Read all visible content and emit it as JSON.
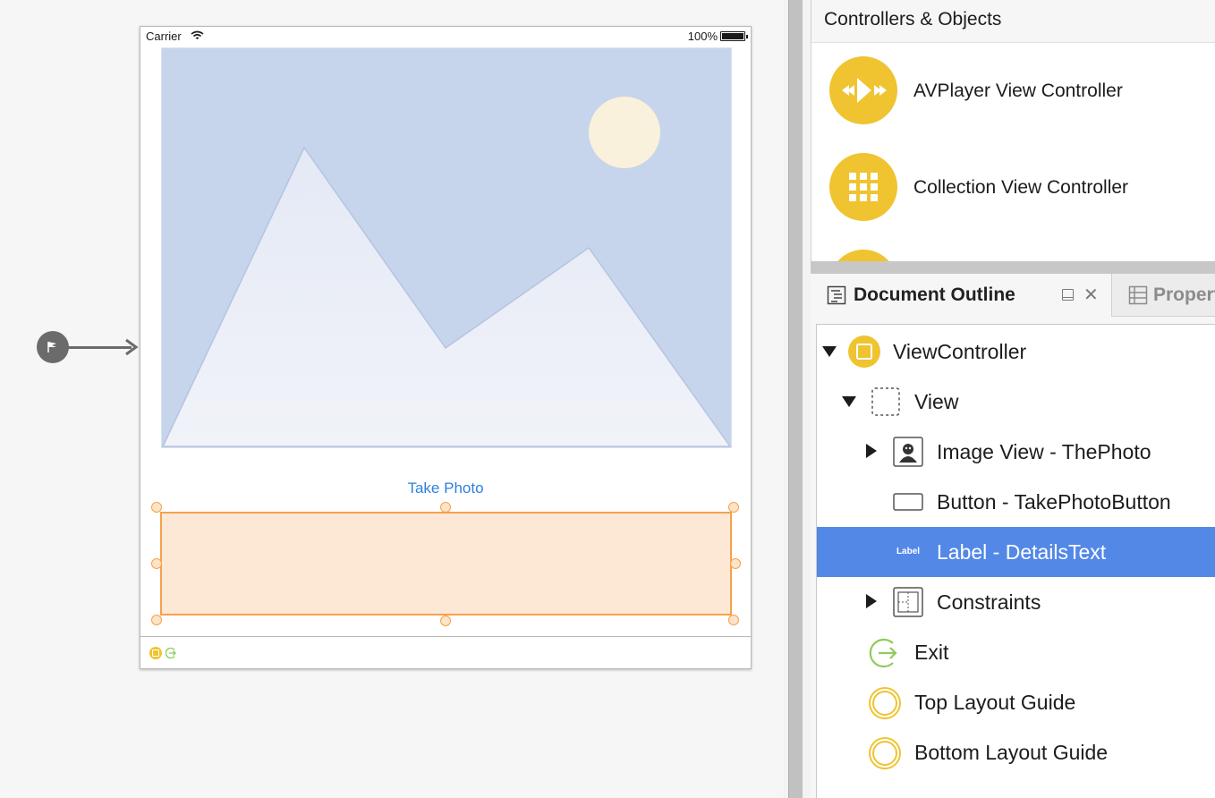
{
  "status_bar": {
    "carrier": "Carrier",
    "battery": "100%"
  },
  "scene": {
    "button_title": "Take Photo"
  },
  "library": {
    "header": "Controllers & Objects",
    "items": [
      {
        "label": "AVPlayer View Controller",
        "icon": "avplayer-icon"
      },
      {
        "label": "Collection View Controller",
        "icon": "collection-grid-icon"
      }
    ]
  },
  "tabs": {
    "document_outline": "Document Outline",
    "properties": "Properties"
  },
  "outline": {
    "selected_index": 3,
    "rows": [
      {
        "label": "ViewController",
        "icon": "view-controller-icon",
        "disclosure": "open"
      },
      {
        "label": "View",
        "icon": "view-icon",
        "disclosure": "open"
      },
      {
        "label": "Image View - ThePhoto",
        "icon": "image-view-icon",
        "disclosure": "closed"
      },
      {
        "label": "Button - TakePhotoButton",
        "icon": "button-icon",
        "disclosure": "none"
      },
      {
        "label": "Label - DetailsText",
        "icon": "label-icon",
        "icon_text": "Label",
        "disclosure": "none"
      },
      {
        "label": "Constraints",
        "icon": "constraints-icon",
        "disclosure": "closed"
      },
      {
        "label": "Exit",
        "icon": "exit-icon",
        "disclosure": "none"
      },
      {
        "label": "Top Layout Guide",
        "icon": "layout-guide-icon",
        "disclosure": "none"
      },
      {
        "label": "Bottom Layout Guide",
        "icon": "layout-guide-icon",
        "disclosure": "none"
      }
    ]
  },
  "colors": {
    "accent_yellow": "#f0c330",
    "selection_blue": "#5388e7",
    "button_blue": "#2f7fdf",
    "label_orange": "#f5a14b"
  }
}
